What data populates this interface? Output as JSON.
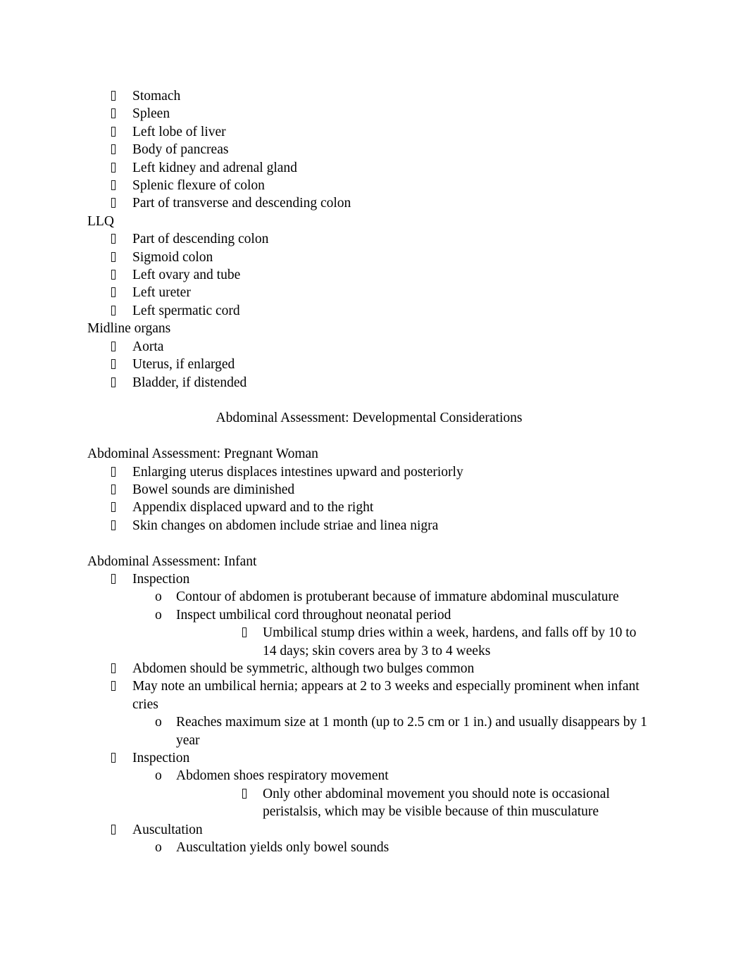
{
  "document": {
    "bullet_glyph": "missing-glyph-box",
    "ordered_marker": "o",
    "text_color": "#000000",
    "background_color": "#ffffff",
    "blocks": [
      {
        "kind": "list-item",
        "level": 1,
        "marker": "tofu",
        "text": "Stomach"
      },
      {
        "kind": "list-item",
        "level": 1,
        "marker": "tofu",
        "text": "Spleen"
      },
      {
        "kind": "list-item",
        "level": 1,
        "marker": "tofu",
        "text": "Left lobe of liver"
      },
      {
        "kind": "list-item",
        "level": 1,
        "marker": "tofu",
        "text": "Body of pancreas"
      },
      {
        "kind": "list-item",
        "level": 1,
        "marker": "tofu",
        "text": "Left kidney and adrenal gland"
      },
      {
        "kind": "list-item",
        "level": 1,
        "marker": "tofu",
        "text": "Splenic flexure of colon"
      },
      {
        "kind": "list-item",
        "level": 1,
        "marker": "tofu",
        "text": "Part of transverse and descending colon"
      },
      {
        "kind": "heading",
        "level": 0,
        "text": "LLQ"
      },
      {
        "kind": "list-item",
        "level": 1,
        "marker": "tofu",
        "text": "Part of descending colon"
      },
      {
        "kind": "list-item",
        "level": 1,
        "marker": "tofu",
        "text": "Sigmoid colon"
      },
      {
        "kind": "list-item",
        "level": 1,
        "marker": "tofu",
        "text": "Left ovary and tube"
      },
      {
        "kind": "list-item",
        "level": 1,
        "marker": "tofu",
        "text": "Left ureter"
      },
      {
        "kind": "list-item",
        "level": 1,
        "marker": "tofu",
        "text": "Left spermatic cord"
      },
      {
        "kind": "heading",
        "level": 0,
        "text": "Midline organs"
      },
      {
        "kind": "list-item",
        "level": 1,
        "marker": "tofu",
        "text": "Aorta"
      },
      {
        "kind": "list-item",
        "level": 1,
        "marker": "tofu",
        "text": "Uterus, if enlarged"
      },
      {
        "kind": "list-item",
        "level": 1,
        "marker": "tofu",
        "text": "Bladder, if distended"
      },
      {
        "kind": "blank"
      },
      {
        "kind": "centered-heading",
        "text": "Abdominal Assessment: Developmental Considerations"
      },
      {
        "kind": "blank"
      },
      {
        "kind": "heading",
        "level": 0,
        "text": "Abdominal Assessment: Pregnant Woman"
      },
      {
        "kind": "list-item",
        "level": 1,
        "marker": "tofu",
        "text": "Enlarging uterus displaces intestines upward and posteriorly"
      },
      {
        "kind": "list-item",
        "level": 1,
        "marker": "tofu",
        "text": "Bowel sounds are diminished"
      },
      {
        "kind": "list-item",
        "level": 1,
        "marker": "tofu",
        "text": "Appendix displaced upward and to the right"
      },
      {
        "kind": "list-item",
        "level": 1,
        "marker": "tofu",
        "text": "Skin changes on abdomen include striae and linea nigra"
      },
      {
        "kind": "blank"
      },
      {
        "kind": "heading",
        "level": 0,
        "text": "Abdominal Assessment: Infant"
      },
      {
        "kind": "list-item",
        "level": 1,
        "marker": "tofu",
        "text": "Inspection"
      },
      {
        "kind": "list-item",
        "level": 2,
        "marker": "o",
        "text": "Contour of abdomen is protuberant because of immature abdominal musculature"
      },
      {
        "kind": "list-item",
        "level": 2,
        "marker": "o",
        "text": "Inspect umbilical cord throughout neonatal period"
      },
      {
        "kind": "list-item",
        "level": 3,
        "marker": "tofu",
        "text": "Umbilical stump dries within a week, hardens, and falls off by 10 to 14 days; skin covers area by 3 to 4 weeks"
      },
      {
        "kind": "list-item",
        "level": 1,
        "marker": "tofu",
        "text": "Abdomen should be symmetric, although two bulges common"
      },
      {
        "kind": "list-item",
        "level": 1,
        "marker": "tofu",
        "text": "May note an umbilical hernia; appears at 2 to 3 weeks and especially prominent when infant cries"
      },
      {
        "kind": "list-item",
        "level": 2,
        "marker": "o",
        "text": "Reaches maximum size at 1 month (up to 2.5 cm or 1 in.) and usually disappears by 1 year"
      },
      {
        "kind": "list-item",
        "level": 1,
        "marker": "tofu",
        "text": "Inspection"
      },
      {
        "kind": "list-item",
        "level": 2,
        "marker": "o",
        "text": "Abdomen shoes respiratory movement"
      },
      {
        "kind": "list-item",
        "level": 3,
        "marker": "tofu",
        "text": "Only other abdominal movement you should note is occasional peristalsis, which may be visible because of thin musculature"
      },
      {
        "kind": "list-item",
        "level": 1,
        "marker": "tofu",
        "text": "Auscultation"
      },
      {
        "kind": "list-item",
        "level": 2,
        "marker": "o",
        "text": "Auscultation yields only bowel sounds"
      }
    ]
  }
}
